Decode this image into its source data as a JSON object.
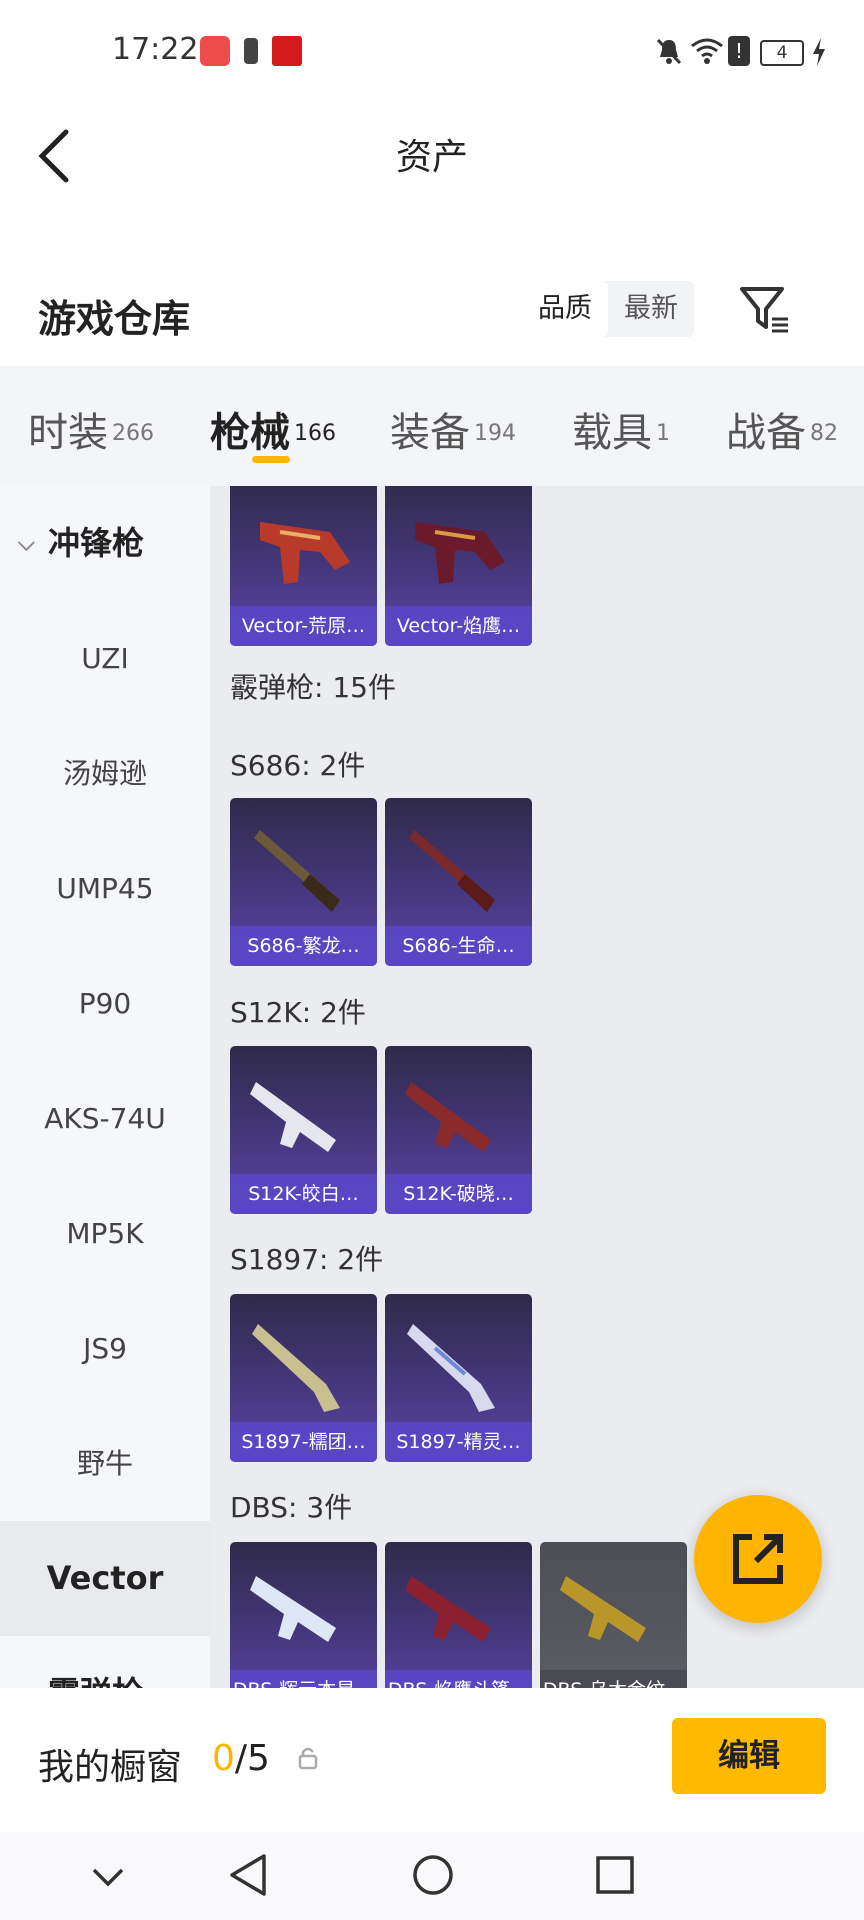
{
  "status_bar": {
    "time": "17:22",
    "battery": "4"
  },
  "header": {
    "title": "资产"
  },
  "warehouse": {
    "title": "游戏仓库",
    "sort_options": [
      "品质",
      "最新"
    ],
    "selected_sort": "品质"
  },
  "tabs": [
    {
      "label": "时装",
      "count": "266"
    },
    {
      "label": "枪械",
      "count": "166",
      "active": true
    },
    {
      "label": "装备",
      "count": "194"
    },
    {
      "label": "载具",
      "count": "1"
    },
    {
      "label": "战备",
      "count": "82"
    }
  ],
  "sidebar": {
    "group_open": "冲锋枪",
    "items": [
      "UZI",
      "汤姆逊",
      "UMP45",
      "P90",
      "AKS-74U",
      "MP5K",
      "JS9",
      "野牛",
      "Vector"
    ],
    "selected": "Vector",
    "group_next": "霰弹枪"
  },
  "content": {
    "top_cards": [
      "Vector-荒原…",
      "Vector-焰鹰…"
    ],
    "category_label": "霰弹枪: 15件",
    "sections": [
      {
        "label": "S686: 2件",
        "cards": [
          "S686-繁龙…",
          "S686-生命…"
        ]
      },
      {
        "label": "S12K: 2件",
        "cards": [
          "S12K-皎白…",
          "S12K-破晓…"
        ]
      },
      {
        "label": "S1897: 2件",
        "cards": [
          "S1897-糯团…",
          "S1897-精灵…"
        ]
      },
      {
        "label": "DBS: 3件",
        "cards": [
          "DBS-辉元本星…",
          "DBS-焰鹰斗篷…",
          "DBS-乌木金纹…"
        ]
      }
    ]
  },
  "showcase": {
    "label": "我的橱窗",
    "count": "0",
    "total": "/5",
    "edit_label": "编辑"
  },
  "colors": {
    "accent": "#ffb400",
    "card_purple": "#4a3a86"
  }
}
